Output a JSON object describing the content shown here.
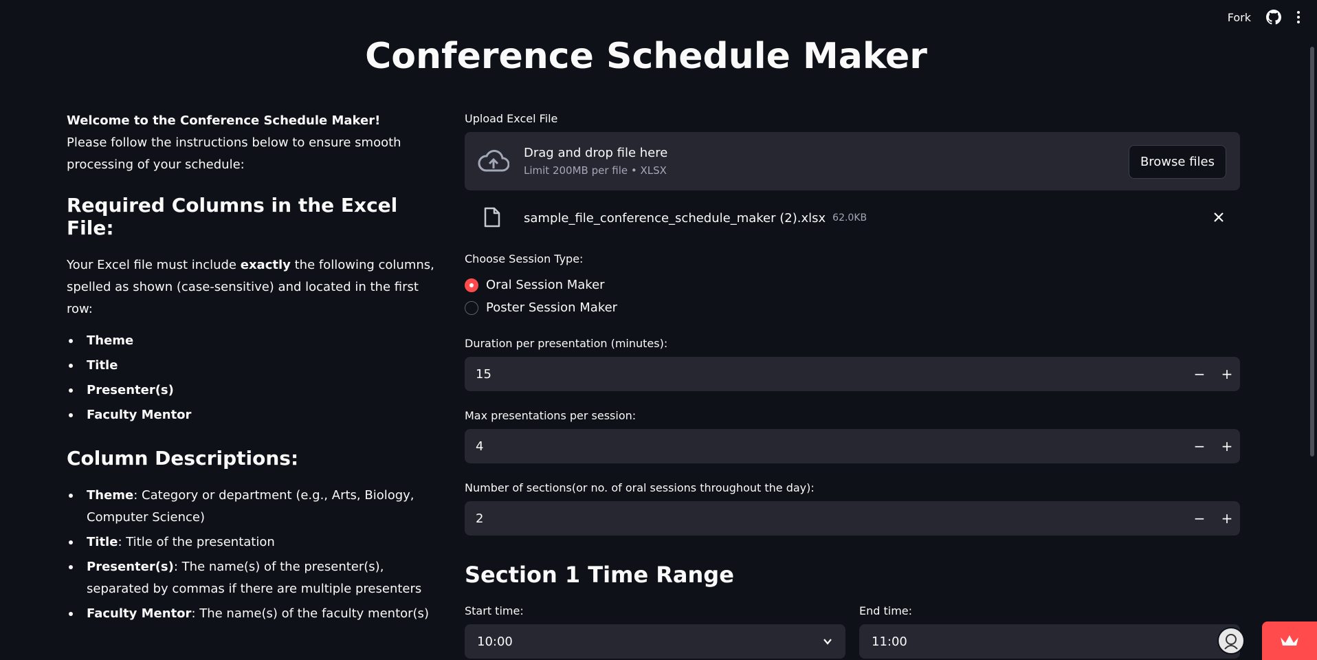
{
  "header": {
    "fork_label": "Fork"
  },
  "title": "Conference Schedule Maker",
  "intro": {
    "welcome": "Welcome to the Conference Schedule Maker!",
    "text": "Please follow the instructions below to ensure smooth processing of your schedule:"
  },
  "required": {
    "heading": "Required Columns in the Excel File:",
    "text_before": "Your Excel file must include ",
    "text_bold": "exactly",
    "text_after": " the following columns, spelled as shown (case-sensitive) and located in the first row:",
    "columns": [
      "Theme",
      "Title",
      "Presenter(s)",
      "Faculty Mentor"
    ]
  },
  "descriptions": {
    "heading": "Column Descriptions:",
    "items": [
      {
        "term": "Theme",
        "desc": ": Category or department (e.g., Arts, Biology, Computer Science)"
      },
      {
        "term": "Title",
        "desc": ": Title of the presentation"
      },
      {
        "term": "Presenter(s)",
        "desc": ": The name(s) of the presenter(s), separated by commas if there are multiple presenters"
      },
      {
        "term": "Faculty Mentor",
        "desc": ": The name(s) of the faculty mentor(s)"
      }
    ]
  },
  "upload": {
    "label": "Upload Excel File",
    "drag_text": "Drag and drop file here",
    "limit_text": "Limit 200MB per file • XLSX",
    "browse_label": "Browse files",
    "file_name": "sample_file_conference_schedule_maker (2).xlsx",
    "file_size": "62.0KB"
  },
  "session_type": {
    "label": "Choose Session Type:",
    "options": [
      "Oral Session Maker",
      "Poster Session Maker"
    ],
    "selected": "Oral Session Maker"
  },
  "duration": {
    "label": "Duration per presentation (minutes):",
    "value": "15"
  },
  "max_presentations": {
    "label": "Max presentations per session:",
    "value": "4"
  },
  "sections": {
    "label": "Number of sections(or no. of oral sessions throughout the day):",
    "value": "2"
  },
  "section1": {
    "heading": "Section 1 Time Range",
    "start_label": "Start time:",
    "start_value": "10:00",
    "end_label": "End time:",
    "end_value": "11:00"
  },
  "colors": {
    "background": "#0e1117",
    "input_bg": "#262730",
    "accent": "#ff4b4b"
  }
}
